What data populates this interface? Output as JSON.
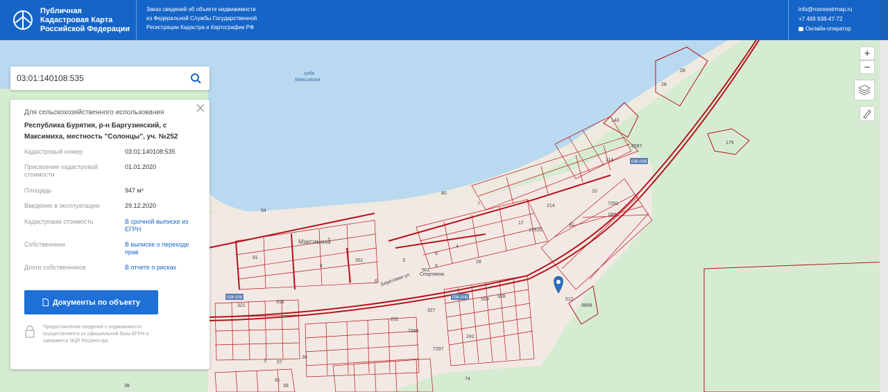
{
  "header": {
    "brand_title_1": "Публичная",
    "brand_title_2": "Кадастровая Карта",
    "brand_title_3": "Российской Федерации",
    "info_line_1": "Заказ сведений об объекте недвижимости",
    "info_line_2": "из Федеральной Службы Государственной",
    "info_line_3": "Регистрации Кадастра и Картографии РФ",
    "email": "info@rosreestrmap.ru",
    "phone": "+7 499 938-47-72",
    "chat": "Онлайн-оператор"
  },
  "search": {
    "value": "03:01:140108:535"
  },
  "panel": {
    "category": "Для сельскохозяйственного использования",
    "address": "Республика Бурятия, р-н Баргузинский, с Максимиха, местность \"Солонцы\", уч. №252",
    "rows": [
      {
        "label": "Кадастровый номер",
        "value": "03:01:140108:535"
      },
      {
        "label": "Присвоение кадастровой стоимости",
        "value": "01.01.2020"
      },
      {
        "label": "Площадь",
        "value": "947 м²"
      },
      {
        "label": "Введение в эксплуатацию",
        "value": "29.12.2020"
      },
      {
        "label": "Кадастровая стоимость",
        "value": "В срочной выписке из ЕГРН"
      },
      {
        "label": "Собственники",
        "value": "В выписке о переходе прав"
      },
      {
        "label": "Долги собственников",
        "value": "В отчете о рисках"
      }
    ],
    "docs_button": "Документы по объекту",
    "note": "Предоставление сведений о недвижимости осуществляется из официальной базы ЕГРН и заверяется ЭЦП Росреестра"
  },
  "map": {
    "water_label_1": "губа",
    "water_label_2": "Максимиха",
    "village_label": "Максимиха",
    "street_label": "Спортивна",
    "street_label_2": "Береговая ул",
    "road_label": "03К-008",
    "zoom_in": "+",
    "zoom_out": "−",
    "parcels": [
      "28",
      "28",
      "140",
      "179",
      "8587",
      "114",
      "10",
      "7",
      "80",
      "214",
      "17",
      "7291",
      "153",
      "41",
      "176",
      "20",
      "4",
      "6",
      "6",
      "28",
      "351",
      "6",
      "501",
      "327",
      "509",
      "508",
      "512",
      "9898",
      "321",
      "316",
      "231",
      "7296",
      "7297",
      "242",
      "39",
      "61",
      "38",
      "57",
      "74",
      "38",
      "3",
      "91",
      "94",
      "6",
      "3",
      "3"
    ]
  },
  "colors": {
    "header": "#1565c8",
    "water": "#b9d9f0",
    "land": "#d6ecd2",
    "parcel": "#b5121b",
    "button": "#1e70d6"
  }
}
